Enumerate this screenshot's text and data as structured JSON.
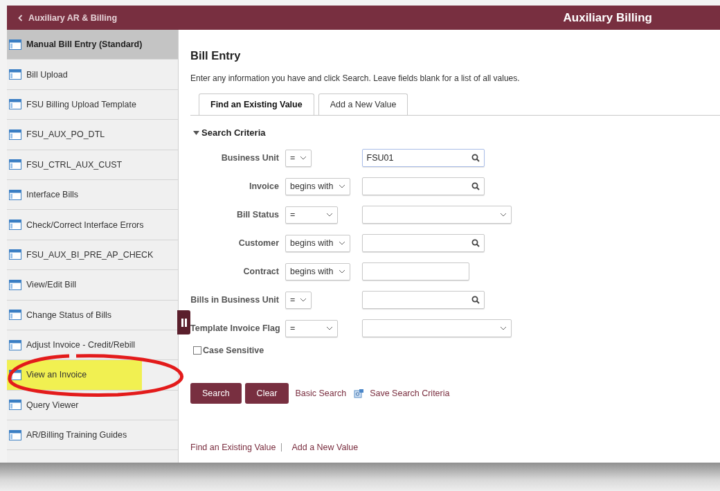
{
  "header": {
    "back_label": "Auxiliary AR & Billing",
    "title": "Auxiliary Billing"
  },
  "sidebar": {
    "items": [
      {
        "label": "Manual Bill Entry (Standard)",
        "selected": true,
        "highlighted": false
      },
      {
        "label": "Bill Upload",
        "selected": false,
        "highlighted": false
      },
      {
        "label": "FSU Billing Upload Template",
        "selected": false,
        "highlighted": false
      },
      {
        "label": "FSU_AUX_PO_DTL",
        "selected": false,
        "highlighted": false
      },
      {
        "label": "FSU_CTRL_AUX_CUST",
        "selected": false,
        "highlighted": false
      },
      {
        "label": "Interface Bills",
        "selected": false,
        "highlighted": false
      },
      {
        "label": "Check/Correct Interface Errors",
        "selected": false,
        "highlighted": false
      },
      {
        "label": "FSU_AUX_BI_PRE_AP_CHECK",
        "selected": false,
        "highlighted": false
      },
      {
        "label": "View/Edit Bill",
        "selected": false,
        "highlighted": false
      },
      {
        "label": "Change Status of Bills",
        "selected": false,
        "highlighted": false
      },
      {
        "label": "Adjust Invoice - Credit/Rebill",
        "selected": false,
        "highlighted": false
      },
      {
        "label": "View an Invoice",
        "selected": false,
        "highlighted": true
      },
      {
        "label": "Query Viewer",
        "selected": false,
        "highlighted": false
      },
      {
        "label": "AR/Billing Training Guides",
        "selected": false,
        "highlighted": false
      }
    ]
  },
  "page": {
    "title": "Bill Entry",
    "instructions": "Enter any information you have and click Search. Leave fields blank for a list of all values.",
    "tabs": [
      {
        "label": "Find an Existing Value",
        "selected": true
      },
      {
        "label": "Add a New Value",
        "selected": false
      }
    ],
    "section": {
      "title": "Search Criteria",
      "expanded": true
    },
    "criteria": [
      {
        "label": "Business Unit",
        "operator": "=",
        "kind": "lookup",
        "value": "FSU01"
      },
      {
        "label": "Invoice",
        "operator": "begins with",
        "kind": "lookup"
      },
      {
        "label": "Bill Status",
        "operator": "=",
        "kind": "dropdown"
      },
      {
        "label": "Customer",
        "operator": "begins with",
        "kind": "lookup"
      },
      {
        "label": "Contract",
        "operator": "begins with",
        "kind": "text"
      },
      {
        "label": "Bills in Business Unit",
        "operator": "=",
        "kind": "lookup"
      },
      {
        "label": "Template Invoice Flag",
        "operator": "=",
        "kind": "dropdown"
      }
    ],
    "case_sensitive": {
      "label": "Case Sensitive",
      "checked": false
    },
    "buttons": [
      "Search",
      "Clear"
    ],
    "links": [
      "Basic Search",
      "Save Search Criteria"
    ],
    "footer_links": [
      "Find an Existing Value",
      "Add a New Value"
    ]
  }
}
